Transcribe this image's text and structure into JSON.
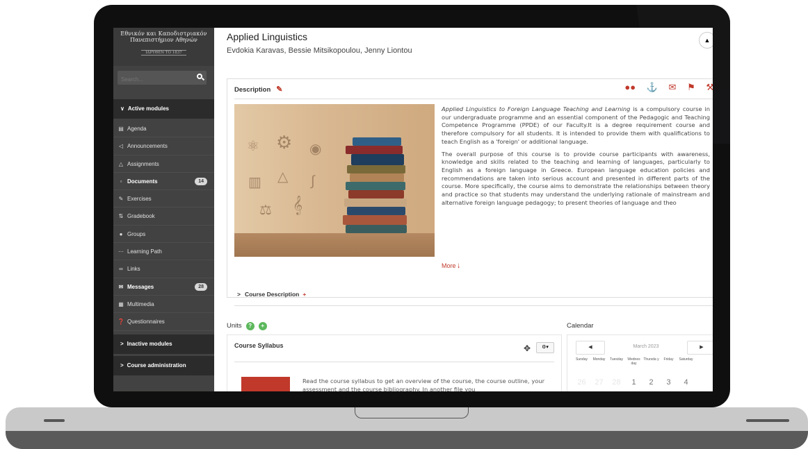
{
  "logo": {
    "line1": "Εθνικόν και Καποδιστριακόν",
    "line2": "Πανεπιστήμιον Αθηνών",
    "line3": "ΙΔΡΥΘΕΝ ΤΟ 1837"
  },
  "search": {
    "placeholder": "Search..."
  },
  "sidebar": {
    "active_header": "Active modules",
    "items": [
      {
        "label": "Agenda",
        "icon": "calendar-icon"
      },
      {
        "label": "Announcements",
        "icon": "megaphone-icon"
      },
      {
        "label": "Assignments",
        "icon": "flask-icon"
      },
      {
        "label": "Documents",
        "icon": "folder-icon",
        "badge": "14"
      },
      {
        "label": "Exercises",
        "icon": "edit-icon"
      },
      {
        "label": "Gradebook",
        "icon": "sort-icon"
      },
      {
        "label": "Groups",
        "icon": "users-icon"
      },
      {
        "label": "Learning Path",
        "icon": "ellipsis-icon"
      },
      {
        "label": "Links",
        "icon": "link-icon"
      },
      {
        "label": "Messages",
        "icon": "envelope-icon",
        "badge": "28"
      },
      {
        "label": "Multimedia",
        "icon": "film-icon"
      },
      {
        "label": "Questionnaires",
        "icon": "question-icon"
      }
    ],
    "inactive_header": "Inactive modules",
    "admin_header": "Course administration"
  },
  "course": {
    "title": "Applied Linguistics",
    "authors": "Evdokia Karavas, Bessie Mitsikopoulou, Jenny Liontou"
  },
  "description": {
    "heading": "Description",
    "para1_italic": "Applied Linguistics to Foreign Language Teaching and Learning",
    "para1_rest": " is a compulsory course in our undergraduate programme and an essential component of the Pedagogic and Teaching Competence Programme (PPDE) of our Faculty.It is a degree requirement course and therefore compulsory for all students. It is intended to provide them with qualifications to teach English as a 'foreign' or additional language.",
    "para2": "The overall purpose of this course is to provide course participants with awareness, knowledge and skills related to the teaching and learning of languages, particularly to English as a foreign language in Greece. European language education policies and recommendations are taken into serious account and presented in different parts of the course. More specifically, the course aims to demonstrate the relationships between theory and practice so that students may understand the underlying rationale of mainstream and alternative foreign language pedagogy; to present theories of language and theo",
    "more": "More",
    "course_desc": "Course Description"
  },
  "units": {
    "heading": "Units",
    "syllabus_title": "Course Syllabus",
    "syllabus_text": "Read the course syllabus to get an overview of the course, the course outline, your assessment and the course bibliography. In another file you"
  },
  "calendar": {
    "heading": "Calendar",
    "month": "March 2023",
    "days": [
      "Sunday",
      "Monday",
      "Tuesday",
      "Wednes day",
      "Thursda y",
      "Friday",
      "Saturday"
    ],
    "row1": [
      "26",
      "27",
      "28",
      "1",
      "2",
      "3",
      "4"
    ]
  },
  "colors": {
    "accent": "#c0392b",
    "sidebar": "#424242",
    "sidebar_header": "#2b2b2b"
  }
}
